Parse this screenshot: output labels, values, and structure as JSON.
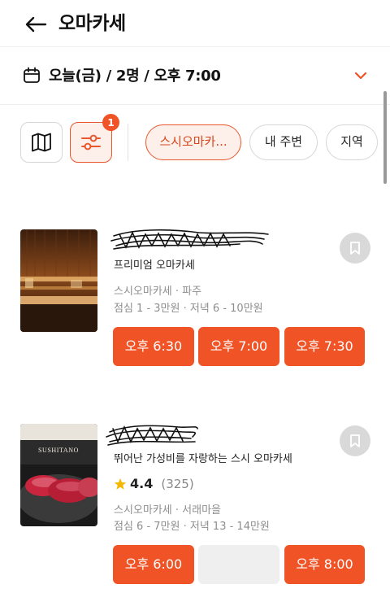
{
  "header": {
    "title": "오마카세",
    "back_icon": "arrow-left-icon"
  },
  "search": {
    "summary": "오늘(금) / 2명 / 오후 7:00",
    "accent_color": "#ef5326"
  },
  "filters": {
    "badge_count": "1",
    "chips": [
      "스시오마카...",
      "내 주변",
      "지역"
    ],
    "active_chip": "스시오마카..."
  },
  "restaurants": [
    {
      "tagline": "프리미엄 오마카세",
      "category_area": "스시오마카세 · 파주",
      "price": "점심 1 - 3만원 · 저녁 6 - 10만원",
      "slots": [
        "오후 6:30",
        "오후 7:00",
        "오후 7:30"
      ]
    },
    {
      "tagline": "뛰어난 가성비를 자랑하는 스시 오마카세",
      "rating": "4.4",
      "review_count": "(325)",
      "category_area": "스시오마카세 · 서래마을",
      "price": "점심 6 - 7만원 · 저녁 13 - 14만원",
      "thumb_text": "SUSHITANO",
      "slots": [
        "오후 6:00",
        "",
        "오후 8:00"
      ]
    }
  ]
}
